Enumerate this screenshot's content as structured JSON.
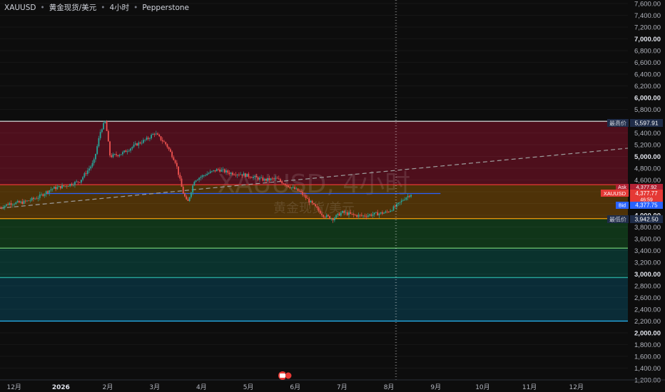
{
  "header": {
    "symbol": "XAUUSD",
    "name": "黄金现货/美元",
    "interval": "4小时",
    "broker": "Pepperstone",
    "separator": "•"
  },
  "watermark": {
    "line1": "XAUUSD, 4小时",
    "line2": "黄金现货/美元"
  },
  "price_tags": {
    "high_label": "最高价",
    "high_value": "5,597.91",
    "ask_label": "Ask",
    "ask_value": "4,377.92",
    "symbol_label": "XAUUSD",
    "last_value": "4,377.77",
    "countdown": "46:59",
    "bid_label": "Bid",
    "bid_value": "4,377.75",
    "low_label": "最低价",
    "low_value": "3,942.50"
  },
  "colors": {
    "background": "#0d0d0d",
    "zone_red": "#5a1020",
    "zone_orange": "#5a3a08",
    "zone_green": "#123d1c",
    "zone_teal": "#0b3a34",
    "zone_cyan": "#0a3340",
    "line_white": "#c8c8c8",
    "line_red": "#e53935",
    "line_orange": "#f59e0b",
    "line_green": "#66bb6a",
    "line_teal": "#26a69a",
    "line_cyan": "#29b6f6",
    "line_blue": "#2962ff",
    "candle_up": "#26a69a",
    "candle_down": "#ef5350",
    "trend_dashed": "#9e9e9e"
  },
  "icons": {
    "event": "event-flag-icon"
  },
  "chart_data": {
    "type": "candlestick",
    "title": "XAUUSD, 4小时",
    "ylim": [
      1200,
      7600
    ],
    "y_ticks": [
      1200,
      1400,
      1600,
      1800,
      2000,
      2200,
      2400,
      2600,
      2800,
      3000,
      3200,
      3400,
      3600,
      3800,
      4000,
      4200,
      4400,
      4600,
      4800,
      5000,
      5200,
      5400,
      5600,
      5800,
      6000,
      6200,
      6400,
      6600,
      6800,
      7000,
      7200,
      7400,
      7600
    ],
    "y_tick_labels": [
      "1,200.00",
      "1,400.00",
      "1,600.00",
      "1,800.00",
      "2,000.00",
      "2,200.00",
      "2,400.00",
      "2,600.00",
      "2,800.00",
      "3,000.00",
      "3,200.00",
      "3,400.00",
      "3,600.00",
      "3,800.00",
      "4,000.00",
      "4,200.00",
      "4,400.00",
      "4,600.00",
      "4,800.00",
      "5,000.00",
      "5,200.00",
      "5,400.00",
      "5,600.00",
      "5,800.00",
      "6,000.00",
      "6,200.00",
      "6,400.00",
      "6,600.00",
      "6,800.00",
      "7,000.00",
      "7,200.00",
      "7,400.00",
      "7,600.00"
    ],
    "bold_ticks": [
      2000,
      3000,
      4000,
      5000,
      6000,
      7000
    ],
    "x_labels": [
      "12月",
      "2026",
      "2月",
      "3月",
      "4月",
      "5月",
      "6月",
      "7月",
      "8月",
      "9月",
      "10月",
      "11月",
      "12月"
    ],
    "x_label_months": [
      11.5,
      12.5,
      13.5,
      14.5,
      15.5,
      16.5,
      17.5,
      18.5,
      19.5,
      20.5,
      21.5,
      22.5,
      23.5
    ],
    "x_range": [
      11.2,
      24.6
    ],
    "last_candle_month": 20.0,
    "price_path": [
      [
        11.2,
        4130
      ],
      [
        11.4,
        4200
      ],
      [
        11.7,
        4220
      ],
      [
        12.0,
        4300
      ],
      [
        12.3,
        4450
      ],
      [
        12.6,
        4500
      ],
      [
        12.9,
        4580
      ],
      [
        13.2,
        4900
      ],
      [
        13.35,
        5450
      ],
      [
        13.45,
        5598
      ],
      [
        13.55,
        5000
      ],
      [
        13.8,
        5050
      ],
      [
        14.1,
        5200
      ],
      [
        14.35,
        5300
      ],
      [
        14.5,
        5400
      ],
      [
        14.75,
        5200
      ],
      [
        14.95,
        4900
      ],
      [
        15.1,
        4400
      ],
      [
        15.2,
        4200
      ],
      [
        15.35,
        4600
      ],
      [
        15.6,
        4700
      ],
      [
        15.85,
        4780
      ],
      [
        16.1,
        4720
      ],
      [
        16.35,
        4700
      ],
      [
        16.6,
        4650
      ],
      [
        16.85,
        4600
      ],
      [
        17.1,
        4620
      ],
      [
        17.35,
        4500
      ],
      [
        17.6,
        4400
      ],
      [
        17.85,
        4200
      ],
      [
        18.1,
        4000
      ],
      [
        18.3,
        3942.5
      ],
      [
        18.5,
        4050
      ],
      [
        18.75,
        4000
      ],
      [
        18.95,
        3990
      ],
      [
        19.2,
        4020
      ],
      [
        19.45,
        4050
      ],
      [
        19.65,
        4150
      ],
      [
        19.85,
        4300
      ],
      [
        20.0,
        4377.77
      ]
    ],
    "levels": [
      {
        "name": "最高价",
        "value": 5597.91,
        "color": "line_white"
      },
      {
        "name": "red",
        "value": 4520,
        "color": "line_red"
      },
      {
        "name": "blue",
        "value": 4370,
        "color": "line_blue"
      },
      {
        "name": "最低价",
        "value": 3942.5,
        "color": "line_orange"
      },
      {
        "name": "green",
        "value": 3440,
        "color": "line_green"
      },
      {
        "name": "teal",
        "value": 2940,
        "color": "line_teal"
      },
      {
        "name": "cyan",
        "value": 2200,
        "color": "line_cyan"
      }
    ],
    "trendline": [
      [
        11.2,
        4120
      ],
      [
        24.6,
        5140
      ]
    ],
    "vertical_marker_month": 19.65
  }
}
